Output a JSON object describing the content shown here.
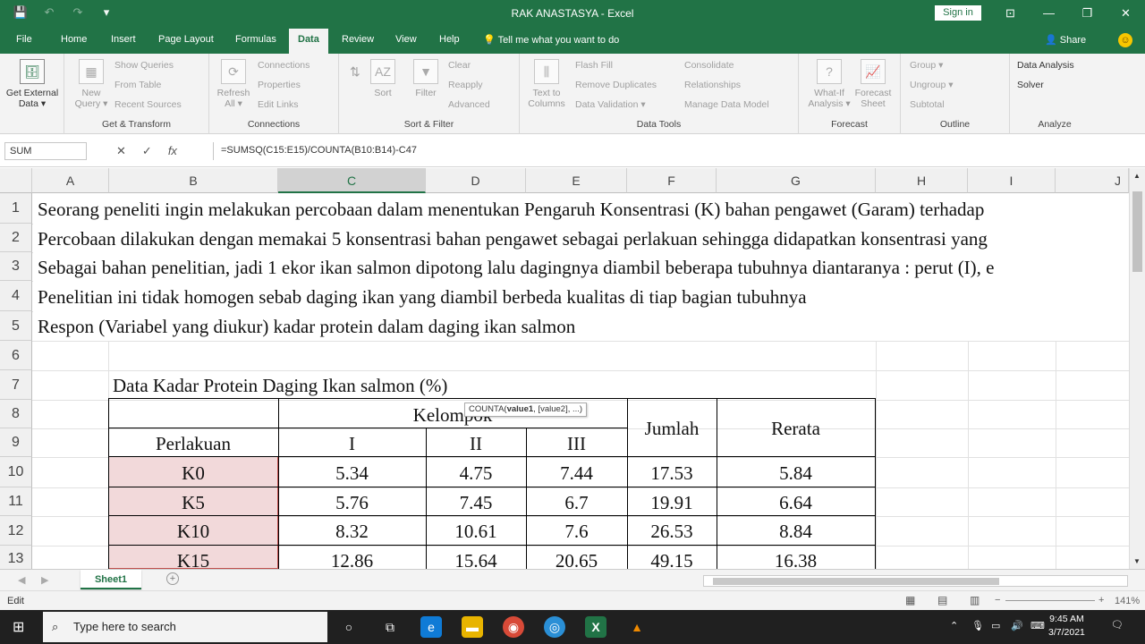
{
  "window": {
    "title": "RAK ANASTASYA  -  Excel",
    "signin": "Sign in",
    "minimize": "—",
    "restore": "❐",
    "close": "✕",
    "ribbon_display": "⊡"
  },
  "qat": {
    "save": "💾",
    "undo": "↶",
    "redo": "↷",
    "customize": "▾"
  },
  "tabs": [
    "File",
    "Home",
    "Insert",
    "Page Layout",
    "Formulas",
    "Data",
    "Review",
    "View",
    "Help"
  ],
  "tell_me": "Tell me what you want to do",
  "share": "Share",
  "ribbon": {
    "get_external": "Get External Data ▾",
    "new_query": "New Query ▾",
    "show_queries": "Show Queries",
    "from_table": "From Table",
    "recent_sources": "Recent Sources",
    "group_get_transform": "Get & Transform",
    "refresh_all": "Refresh All ▾",
    "connections": "Connections",
    "properties": "Properties",
    "edit_links": "Edit Links",
    "group_connections": "Connections",
    "sort": "Sort",
    "filter": "Filter",
    "clear": "Clear",
    "reapply": "Reapply",
    "advanced": "Advanced",
    "group_sort_filter": "Sort & Filter",
    "text_to_columns": "Text to Columns",
    "flash_fill": "Flash Fill",
    "remove_duplicates": "Remove Duplicates",
    "data_validation": "Data Validation ▾",
    "consolidate": "Consolidate",
    "relationships": "Relationships",
    "manage_data_model": "Manage Data Model",
    "group_data_tools": "Data Tools",
    "what_if": "What-If Analysis ▾",
    "forecast_sheet": "Forecast Sheet",
    "group_forecast": "Forecast",
    "group": "Group ▾",
    "ungroup": "Ungroup ▾",
    "subtotal": "Subtotal",
    "group_outline": "Outline",
    "data_analysis": "Data Analysis",
    "solver": "Solver",
    "group_analyze": "Analyze"
  },
  "formula_bar": {
    "name_box": "SUM",
    "cancel": "✕",
    "enter": "✓",
    "fx": "fx",
    "formula": "=SUMSQ(C15:E15)/COUNTA(B10:B14)-C47"
  },
  "columns": [
    "A",
    "B",
    "C",
    "D",
    "E",
    "F",
    "G",
    "H",
    "I",
    "J"
  ],
  "rows": [
    "1",
    "2",
    "3",
    "4",
    "5",
    "6",
    "7",
    "8",
    "9",
    "10",
    "11",
    "12",
    "13"
  ],
  "text_rows": [
    "Seorang peneliti ingin melakukan percobaan dalam menentukan Pengaruh Konsentrasi (K) bahan pengawet (Garam) terhadap",
    "Percobaan dilakukan dengan memakai 5 konsentrasi bahan pengawet sebagai perlakuan sehingga didapatkan konsentrasi yang",
    "Sebagai bahan penelitian, jadi 1 ekor ikan salmon dipotong lalu dagingnya diambil beberapa tubuhnya diantaranya : perut (I), e",
    "Penelitian ini tidak homogen sebab daging ikan yang diambil berbeda kualitas di tiap bagian tubuhnya",
    "Respon (Variabel yang diukur) kadar protein dalam daging ikan salmon"
  ],
  "table": {
    "title": "Data Kadar Protein Daging Ikan salmon (%)",
    "kelompok": "Kelompok",
    "perlakuan": "Perlakuan",
    "jumlah": "Jumlah",
    "rerata": "Rerata",
    "groups": [
      "I",
      "II",
      "III"
    ],
    "data": [
      [
        "K0",
        "5.34",
        "4.75",
        "7.44",
        "17.53",
        "5.84"
      ],
      [
        "K5",
        "5.76",
        "7.45",
        "6.7",
        "19.91",
        "6.64"
      ],
      [
        "K10",
        "8.32",
        "10.61",
        "7.6",
        "26.53",
        "8.84"
      ],
      [
        "K15",
        "12.86",
        "15.64",
        "20.65",
        "49.15",
        "16.38"
      ]
    ]
  },
  "tooltip": {
    "fn": "COUNTA(",
    "arg1": "value1",
    ", ": ", ",
    "rest": "[value2], ...)"
  },
  "sheet": {
    "tab": "Sheet1",
    "add": "+"
  },
  "status": {
    "mode": "Edit",
    "zoom": "141%"
  },
  "taskbar": {
    "search_placeholder": "Type here to search",
    "time": "9:45 AM",
    "date": "3/7/2021"
  }
}
